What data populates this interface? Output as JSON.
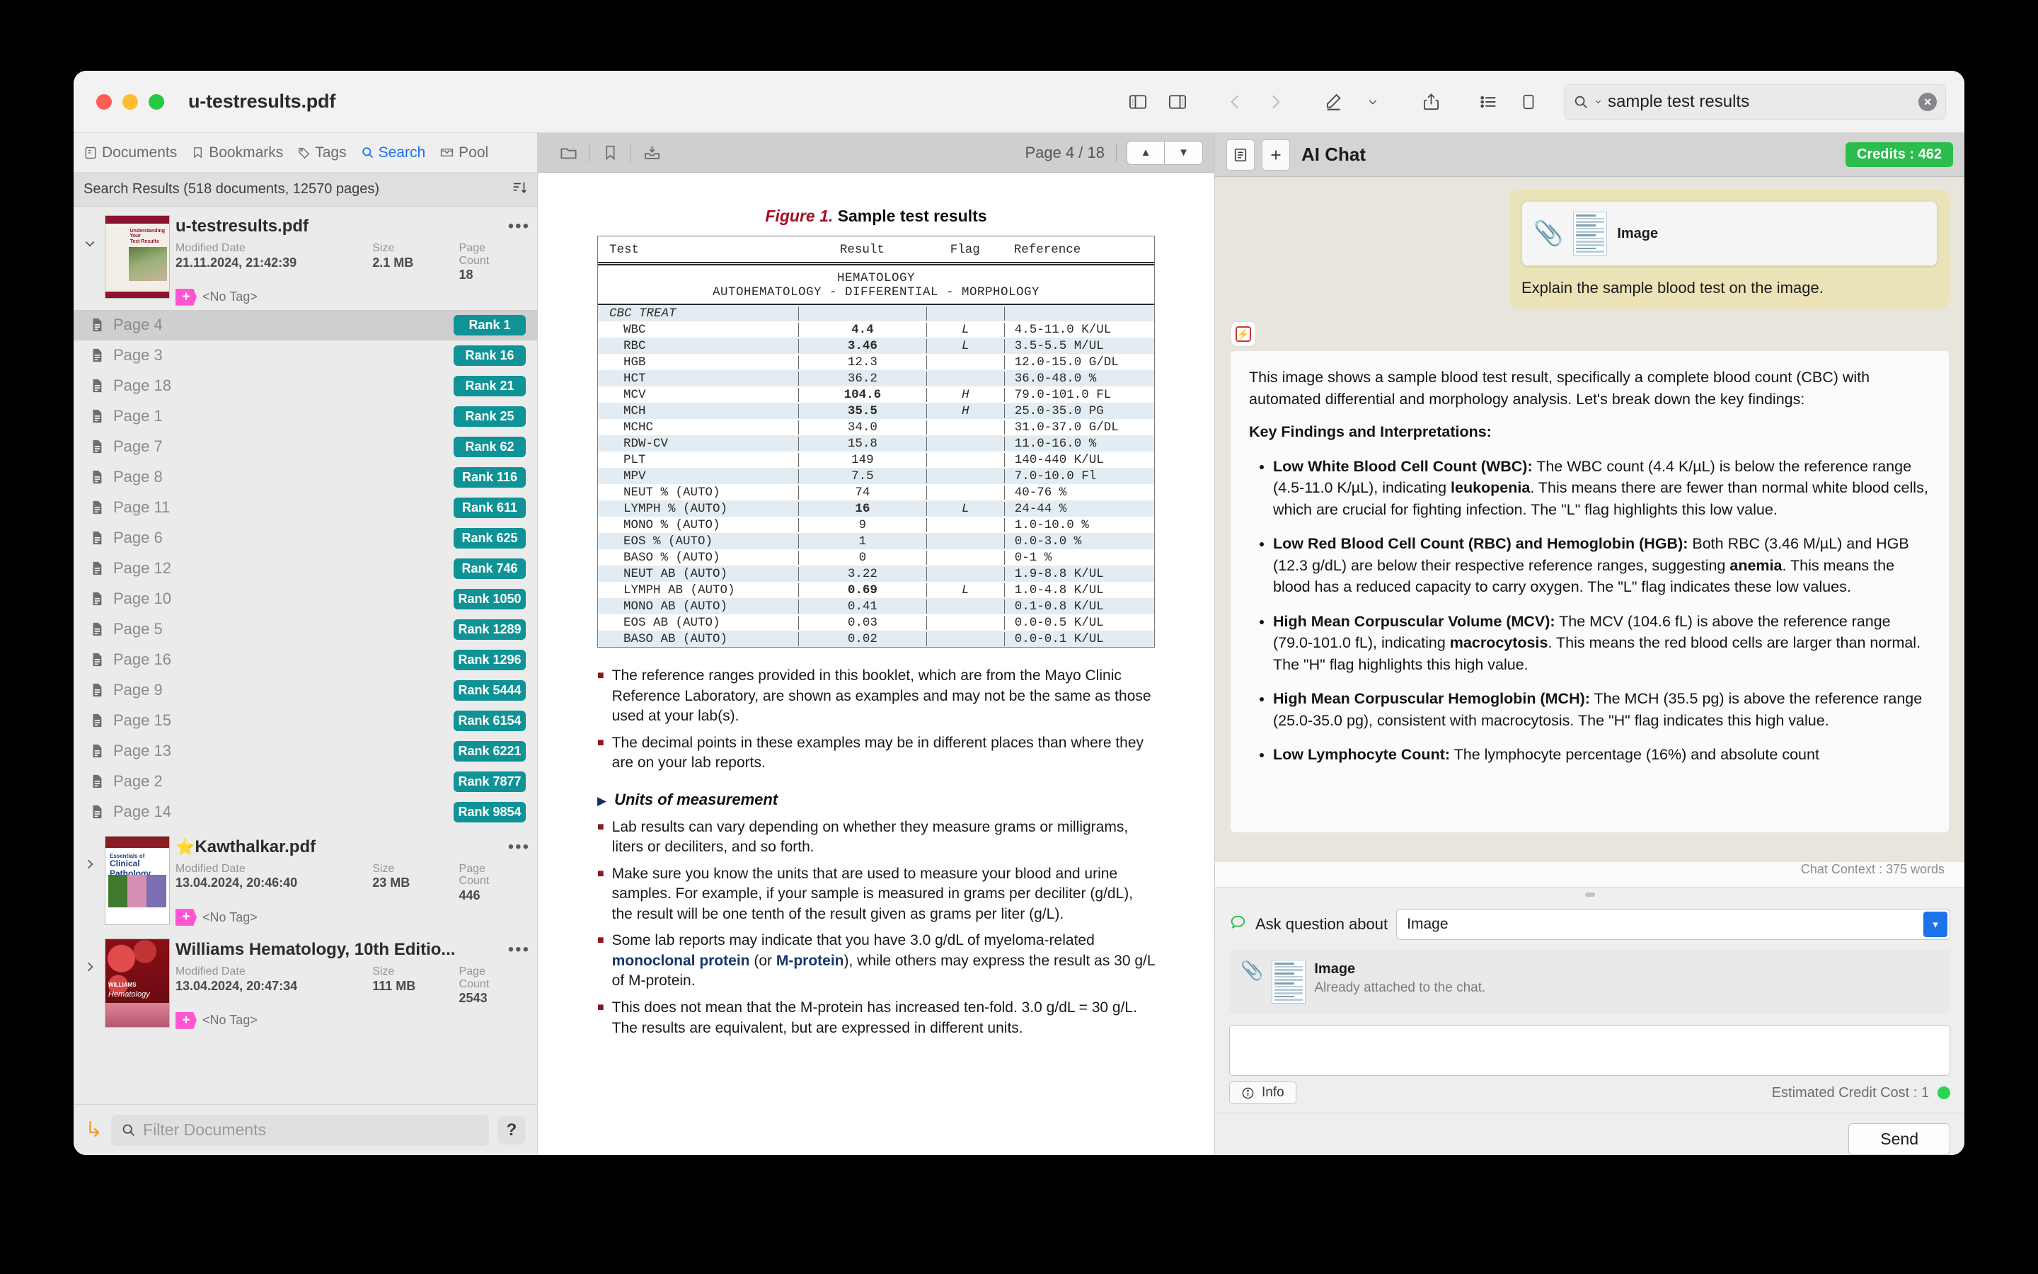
{
  "window": {
    "title": "u-testresults.pdf"
  },
  "toolbar": {
    "icons": [
      "sidebar-left-icon",
      "sidebar-right-icon",
      "back-icon",
      "forward-icon",
      "annotate-icon",
      "chevron-down-icon",
      "share-icon",
      "list-icon",
      "page-icon"
    ],
    "search_value": "sample test results"
  },
  "sidebar": {
    "tabs": [
      {
        "label": "Documents",
        "icon": "documents-icon",
        "active": false
      },
      {
        "label": "Bookmarks",
        "icon": "bookmark-icon",
        "active": false
      },
      {
        "label": "Tags",
        "icon": "tag-icon",
        "active": false
      },
      {
        "label": "Search",
        "icon": "search-icon",
        "active": true
      },
      {
        "label": "Pool",
        "icon": "pool-icon",
        "active": false
      }
    ],
    "results_header": "Search Results (518 documents, 12570 pages)",
    "sort_icon": "sort-descending-icon",
    "documents": [
      {
        "title": "u-testresults.pdf",
        "starred": false,
        "expanded": true,
        "labels": {
          "modified": "Modified Date",
          "size": "Size",
          "pages": "Page Count"
        },
        "modified_date": "21.11.2024, 21:42:39",
        "size": "2.1 MB",
        "page_count": "18",
        "tag": "<No Tag>"
      },
      {
        "title": "Kawthalkar.pdf",
        "starred": true,
        "expanded": false,
        "labels": {
          "modified": "Modified Date",
          "size": "Size",
          "pages": "Page Count"
        },
        "modified_date": "13.04.2024, 20:46:40",
        "size": "23 MB",
        "page_count": "446",
        "tag": "<No Tag>"
      },
      {
        "title": "Williams Hematology, 10th Editio...",
        "starred": false,
        "expanded": false,
        "labels": {
          "modified": "Modified Date",
          "size": "Size",
          "pages": "Page Count"
        },
        "modified_date": "13.04.2024, 20:47:34",
        "size": "111 MB",
        "page_count": "2543",
        "tag": "<No Tag>"
      }
    ],
    "pages": [
      {
        "label": "Page 4",
        "rank": "Rank 1",
        "selected": true
      },
      {
        "label": "Page 3",
        "rank": "Rank 16",
        "selected": false
      },
      {
        "label": "Page 18",
        "rank": "Rank 21",
        "selected": false
      },
      {
        "label": "Page 1",
        "rank": "Rank 25",
        "selected": false
      },
      {
        "label": "Page 7",
        "rank": "Rank 62",
        "selected": false
      },
      {
        "label": "Page 8",
        "rank": "Rank 116",
        "selected": false
      },
      {
        "label": "Page 11",
        "rank": "Rank 611",
        "selected": false
      },
      {
        "label": "Page 6",
        "rank": "Rank 625",
        "selected": false
      },
      {
        "label": "Page 12",
        "rank": "Rank 746",
        "selected": false
      },
      {
        "label": "Page 10",
        "rank": "Rank 1050",
        "selected": false
      },
      {
        "label": "Page 5",
        "rank": "Rank 1289",
        "selected": false
      },
      {
        "label": "Page 16",
        "rank": "Rank 1296",
        "selected": false
      },
      {
        "label": "Page 9",
        "rank": "Rank 5444",
        "selected": false
      },
      {
        "label": "Page 15",
        "rank": "Rank 6154",
        "selected": false
      },
      {
        "label": "Page 13",
        "rank": "Rank 6221",
        "selected": false
      },
      {
        "label": "Page 2",
        "rank": "Rank 7877",
        "selected": false
      },
      {
        "label": "Page 14",
        "rank": "Rank 9854",
        "selected": false
      }
    ],
    "filter_placeholder": "Filter Documents",
    "help_label": "?",
    "return_icon": "return-arrow-icon"
  },
  "viewer": {
    "toolbar_icons": [
      "folder-icon",
      "bookmark-icon",
      "download-inbox-icon"
    ],
    "page_indicator": "Page 4 / 18",
    "prev_label": "▲",
    "next_label": "▼",
    "document": {
      "figure_prefix": "Figure 1.",
      "figure_title": "Sample test results",
      "table": {
        "headers": [
          "Test",
          "Result",
          "Flag",
          "Reference"
        ],
        "section_line1": "HEMATOLOGY",
        "section_line2": "AUTOHEMATOLOGY - DIFFERENTIAL - MORPHOLOGY",
        "group_label": "CBC TREAT",
        "rows": [
          {
            "test": "WBC",
            "result": "4.4",
            "flag": "L",
            "ref": "4.5-11.0 K/UL",
            "bold": true
          },
          {
            "test": "RBC",
            "result": "3.46",
            "flag": "L",
            "ref": "3.5-5.5 M/UL",
            "bold": true
          },
          {
            "test": "HGB",
            "result": "12.3",
            "flag": "",
            "ref": "12.0-15.0 G/DL",
            "bold": false
          },
          {
            "test": "HCT",
            "result": "36.2",
            "flag": "",
            "ref": "36.0-48.0 %",
            "bold": false
          },
          {
            "test": "MCV",
            "result": "104.6",
            "flag": "H",
            "ref": "79.0-101.0 FL",
            "bold": true
          },
          {
            "test": "MCH",
            "result": "35.5",
            "flag": "H",
            "ref": "25.0-35.0 PG",
            "bold": true
          },
          {
            "test": "MCHC",
            "result": "34.0",
            "flag": "",
            "ref": "31.0-37.0 G/DL",
            "bold": false
          },
          {
            "test": "RDW-CV",
            "result": "15.8",
            "flag": "",
            "ref": "11.0-16.0 %",
            "bold": false
          },
          {
            "test": "PLT",
            "result": "149",
            "flag": "",
            "ref": "140-440 K/UL",
            "bold": false
          },
          {
            "test": "MPV",
            "result": "7.5",
            "flag": "",
            "ref": "7.0-10.0 Fl",
            "bold": false
          },
          {
            "test": "NEUT  %  (AUTO)",
            "result": "74",
            "flag": "",
            "ref": "40-76 %",
            "bold": false
          },
          {
            "test": "LYMPH %  (AUTO)",
            "result": "16",
            "flag": "L",
            "ref": "24-44 %",
            "bold": true
          },
          {
            "test": "MONO  %  (AUTO)",
            "result": "9",
            "flag": "",
            "ref": "1.0-10.0 %",
            "bold": false
          },
          {
            "test": "EOS   %  (AUTO)",
            "result": "1",
            "flag": "",
            "ref": "0.0-3.0 %",
            "bold": false
          },
          {
            "test": "BASO  %  (AUTO)",
            "result": "0",
            "flag": "",
            "ref": "0-1 %",
            "bold": false
          },
          {
            "test": "NEUT  AB (AUTO)",
            "result": "3.22",
            "flag": "",
            "ref": "1.9-8.8 K/UL",
            "bold": false
          },
          {
            "test": "LYMPH AB (AUTO)",
            "result": "0.69",
            "flag": "L",
            "ref": "1.0-4.8 K/UL",
            "bold": true
          },
          {
            "test": "MONO  AB (AUTO)",
            "result": "0.41",
            "flag": "",
            "ref": "0.1-0.8 K/UL",
            "bold": false
          },
          {
            "test": "EOS   AB (AUTO)",
            "result": "0.03",
            "flag": "",
            "ref": "0.0-0.5 K/UL",
            "bold": false
          },
          {
            "test": "BASO  AB (AUTO)",
            "result": "0.02",
            "flag": "",
            "ref": "0.0-0.1 K/UL",
            "bold": false
          }
        ]
      },
      "bullets_top": [
        "The reference ranges provided in this booklet, which are from the Mayo Clinic Reference Laboratory, are shown as examples and may not be the same as those used at your lab(s).",
        "The decimal points in these examples may be in different places than where they are on your lab reports."
      ],
      "section_heading": "Units of measurement",
      "bullets_units_1": "Lab results can vary depending on whether they measure grams or milligrams, liters or deciliters, and so forth.",
      "bullets_units_2": "Make sure you know the units that are used to measure your blood and urine samples. For example, if your sample is measured in grams per deciliter (g/dL), the result will be one tenth of the result given as grams per liter (g/L).",
      "bullets_units_3a": "Some lab reports may indicate that you have 3.0 g/dL of myeloma-related ",
      "bullets_units_3b": "monoclonal protein",
      "bullets_units_3c": " (or ",
      "bullets_units_3d": "M-protein",
      "bullets_units_3e": "), while others may express the result as 30 g/L of M-protein.",
      "bullets_units_4": "This does not mean that the M-protein has increased ten-fold. 3.0 g/dL = 30 g/L. The results are equivalent, but are expressed in different units."
    }
  },
  "chat": {
    "title": "AI Chat",
    "history_icon": "history-list-icon",
    "new_icon": "plus-icon",
    "credits_badge": "Credits : 462",
    "user_message": {
      "attachment_label": "Image",
      "text": "Explain the sample blood test on the image."
    },
    "assistant": {
      "intro": "This image shows a sample blood test result, specifically a complete blood count (CBC) with automated differential and morphology analysis. Let's break down the key findings:",
      "heading": "Key Findings and Interpretations:",
      "findings": [
        {
          "title": "Low White Blood Cell Count (WBC):",
          "body_a": " The WBC count (4.4 K/µL) is below the reference range (4.5-11.0 K/µL), indicating ",
          "em": "leukopenia",
          "body_b": ". This means there are fewer than normal white blood cells, which are crucial for fighting infection. The \"L\" flag highlights this low value."
        },
        {
          "title": "Low Red Blood Cell Count (RBC) and Hemoglobin (HGB):",
          "body_a": " Both RBC (3.46 M/µL) and HGB (12.3 g/dL) are below their respective reference ranges, suggesting ",
          "em": "anemia",
          "body_b": ". This means the blood has a reduced capacity to carry oxygen. The \"L\" flag indicates these low values."
        },
        {
          "title": "High Mean Corpuscular Volume (MCV):",
          "body_a": " The MCV (104.6 fL) is above the reference range (79.0-101.0 fL), indicating ",
          "em": "macrocytosis",
          "body_b": ". This means the red blood cells are larger than normal. The \"H\" flag highlights this high value."
        },
        {
          "title": "High Mean Corpuscular Hemoglobin (MCH):",
          "body_a": " The MCH (35.5 pg) is above the reference range (25.0-35.0 pg), consistent with macrocytosis. The \"H\" flag indicates this high value.",
          "em": "",
          "body_b": ""
        },
        {
          "title": "Low Lymphocyte Count:",
          "body_a": " The lymphocyte percentage (16%) and absolute count",
          "em": "",
          "body_b": ""
        }
      ]
    },
    "context_label": "Chat Context : 375 words",
    "ask_label": "Ask question about",
    "ask_value": "Image",
    "attachment": {
      "name": "Image",
      "status": "Already attached to the chat."
    },
    "compose_value": "",
    "info_label": "Info",
    "credit_cost": "Estimated Credit Cost : 1",
    "send_label": "Send"
  }
}
